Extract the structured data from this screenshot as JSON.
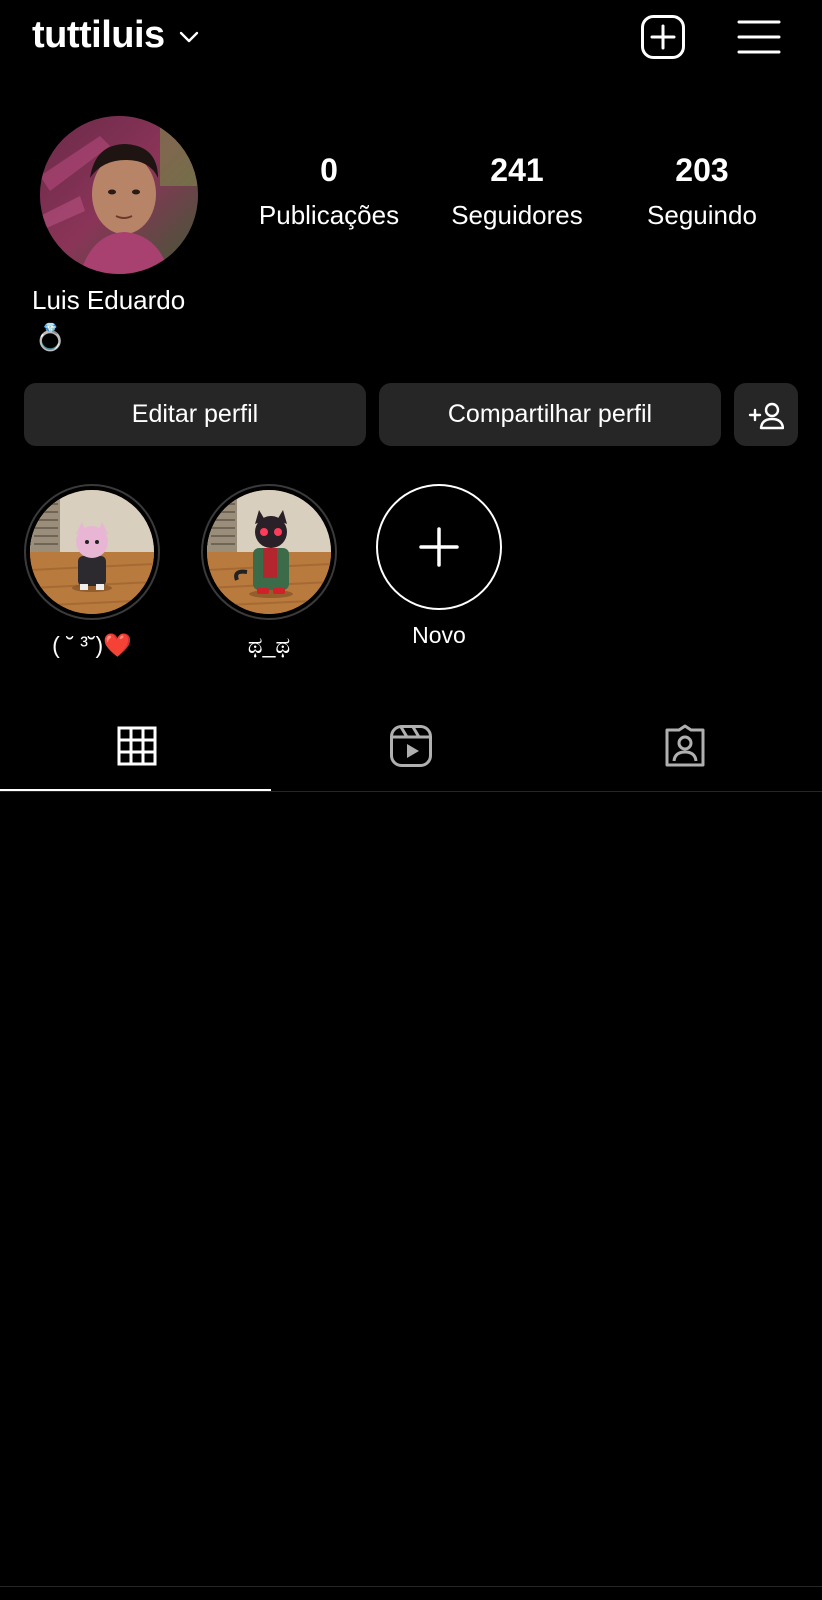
{
  "header": {
    "username": "tuttiluis"
  },
  "profile": {
    "full_name": "Luis Eduardo",
    "bio": "💍",
    "stats": [
      {
        "value": "0",
        "label": "Publicações"
      },
      {
        "value": "241",
        "label": "Seguidores"
      },
      {
        "value": "203",
        "label": "Seguindo"
      }
    ]
  },
  "actions": {
    "edit_label": "Editar perfil",
    "share_label": "Compartilhar perfil"
  },
  "highlights": [
    {
      "label": "( ˘ ³˘)❤️"
    },
    {
      "label": "ಥ_ಥ"
    },
    {
      "label": "Novo"
    }
  ],
  "tabs": [
    {
      "name": "grid-icon"
    },
    {
      "name": "reels-icon"
    },
    {
      "name": "tagged-icon"
    }
  ],
  "colors": {
    "background": "#000000",
    "button": "#262626",
    "text": "#ffffff"
  }
}
